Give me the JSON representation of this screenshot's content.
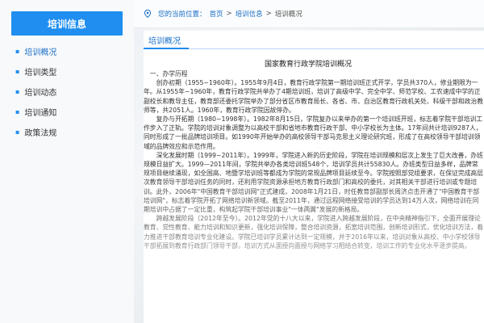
{
  "sidebar": {
    "title": "培训信息",
    "items": [
      {
        "label": "培训概况"
      },
      {
        "label": "培训类型"
      },
      {
        "label": "培训动态"
      },
      {
        "label": "培训通知"
      },
      {
        "label": "政策法规"
      }
    ],
    "accent": "#1f8ef0"
  },
  "breadcrumb": {
    "prefix": "您的当前位置：",
    "home": "首页",
    "sep1": ">",
    "section": "培训信息",
    "sep2": ">",
    "current": "培训概况"
  },
  "content": {
    "tab": "培训概况",
    "title": "国家教育行政学院培训概况",
    "heading1": "一、办学历程",
    "paragraphs": [
      "创办初期（1955~1960年）。1955年9月4日，教育行政学院第一期培训班正式开学，学员共370人，修业期限为一年。从1955年~1960年，教育行政学院共举办了4期培训班，培训了高级中学、完全中学、师范学校、工农速成中学的正副校长和教导主任，教育部还委托学院举办了部分省区市教育局长、各省、市、自治区教育行政机关处、科级干部和政治教师等，共2051人。1960年，教育行政学院因故停办。",
      "复办与开拓期（1980~1998年）。1982年8月15日，学院复办以来举办的第一个培训班开班，标志着学院干部培训工作步入了正轨。学院的培训对象调整为以高校干部和省地市教育行政干部、中小学校长为主体。17年间共计培训9287人，同时形成了一批品牌培训项目。如1990年开始举办的高校领导干部马克思主义理论研究班，形成了在高校领导干部培训领域的品牌效应和示范作用。",
      "深化发展时期（1999~2011年）。1999年，学院进入新的历史阶段，学院在培训规模和层次上发生了巨大改善，办班规模日益扩大。1999—2011年间，学院共举办各类培训班548个，培训学员共计55830人。办班类型日益多样，品牌常规项目继续涌现，如全国高、地暨学培训班等都成为学院的常规品牌项目延续至今。学院按照部党组要求，在保证完成高层次教育领导干部培训任务的同时，还利用学院资源承担地方教育行政部门和高校的委托，对其相关干部进行培训或专题培训。此外，2006年\"中国教育干部培训网\"正式建成，2008年1月21日，时任教育部副部长周济点击开通了\"中国教育干部培训网\"，标志着学院开拓了网络培训新领域。截至2011年，通过远程网络接受培训的学员达到14万人次，网络培训在同期培训中占据了一定比重，构筑起学院干部培训事业\"一体两翼\"发展的新格局。",
      "跨越发展阶段（2012年至今）。2012年党的十八大以来，学院进入跨越发展阶段，在中央精神指引下，全面开展理论教育、党性教育、能力培训和知识更新，强化培训保障，整合培训资源，拓宽培训范围，创新培训形式，优化培训方法，着力推进干部教育培训专业化建设。学院已培训学员累计达到一定规模，并于2016年以来，培训对象从高校、中小学校领导干部拓展到教育行政部门领导干部，培训方式从面授向面授与网络学习相结合转变，培训工作的专业化水平逐步提高。"
    ]
  }
}
